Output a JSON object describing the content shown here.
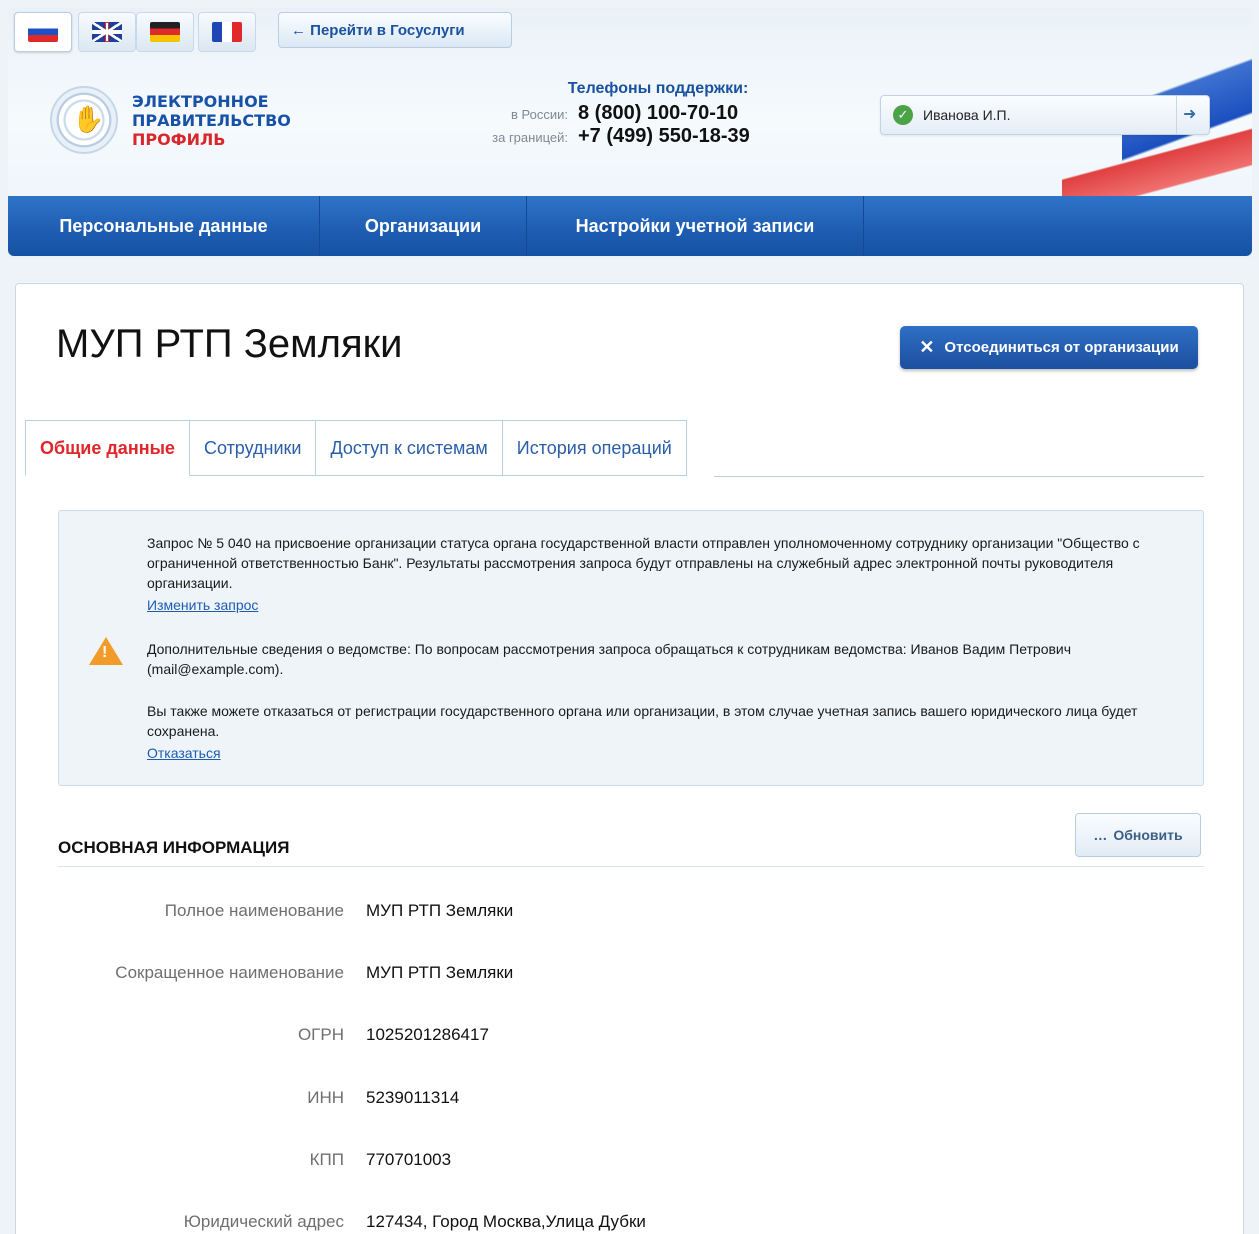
{
  "header": {
    "languages": [
      {
        "code": "ru",
        "flag": "russian-flag-icon",
        "active": true
      },
      {
        "code": "en",
        "flag": "uk-flag-icon",
        "active": false
      },
      {
        "code": "de",
        "flag": "german-flag-icon",
        "active": false
      },
      {
        "code": "fr",
        "flag": "french-flag-icon",
        "active": false
      }
    ],
    "goto_button": "← Перейти в Госуслуги",
    "logo": {
      "line1": "ЭЛЕКТРОННОЕ",
      "line2": "ПРАВИТЕЛЬСТВО",
      "line3": "ПРОФИЛЬ"
    },
    "support": {
      "title": "Телефоны поддержки:",
      "russia_label": "в России:",
      "russia_number": "8 (800) 100-70-10",
      "abroad_label": "за границей:",
      "abroad_number": "+7 (499) 550-18-39"
    },
    "user": {
      "name": "Иванова И.П.",
      "status_icon": "check-icon",
      "logout_icon": "logout-icon"
    }
  },
  "nav": {
    "items": [
      {
        "label": "Персональные данные"
      },
      {
        "label": "Организации"
      },
      {
        "label": "Настройки учетной записи"
      }
    ]
  },
  "main": {
    "title": "МУП РТП Земляки",
    "detach_button": "Отсоединиться от организации",
    "tabs": [
      {
        "label": "Общие данные",
        "active": true
      },
      {
        "label": "Сотрудники",
        "active": false
      },
      {
        "label": "Доступ к системам",
        "active": false
      },
      {
        "label": "История операций",
        "active": false
      }
    ],
    "notice": {
      "paragraph1": "Запрос № 5 040 на присвоение организации статуса органа государственной власти отправлен уполномоченному сотруднику организации \"Общество с ограниченной ответственностью Банк\". Результаты рассмотрения запроса будут отправлены на служебный адрес электронной почты руководителя организации.",
      "link1": "Изменить запрос",
      "paragraph2": "Дополнительные сведения о ведомстве: По вопросам рассмотрения запроса обращаться к сотрудникам ведомства: Иванов Вадим Петрович (mail@example.com).",
      "paragraph3": "Вы также можете отказаться от регистрации государственного органа или организации, в этом случае учетная запись вашего юридического лица будет сохранена.",
      "link2": "Отказаться"
    },
    "refresh_button": "Обновить",
    "section_title": "ОСНОВНАЯ ИНФОРМАЦИЯ",
    "fields": [
      {
        "label": "Полное наименование",
        "value": "МУП РТП Земляки"
      },
      {
        "label": "Сокращенное наименование",
        "value": "МУП РТП Земляки"
      },
      {
        "label": "ОГРН",
        "value": "1025201286417"
      },
      {
        "label": "ИНН",
        "value": "5239011314"
      },
      {
        "label": "КПП",
        "value": "770701003"
      },
      {
        "label": "Юридический адрес",
        "value": "127434, Город Москва,Улица Дубки"
      }
    ]
  }
}
